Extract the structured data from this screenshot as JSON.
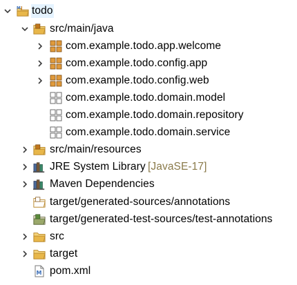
{
  "tree": {
    "root": {
      "label": "todo"
    },
    "items": [
      {
        "label": "src/main/java"
      },
      {
        "label": "com.example.todo.app.welcome"
      },
      {
        "label": "com.example.todo.config.app"
      },
      {
        "label": "com.example.todo.config.web"
      },
      {
        "label": "com.example.todo.domain.model"
      },
      {
        "label": "com.example.todo.domain.repository"
      },
      {
        "label": "com.example.todo.domain.service"
      },
      {
        "label": "src/main/resources"
      },
      {
        "label": "JRE System Library",
        "decoration": "[JavaSE-17]"
      },
      {
        "label": "Maven Dependencies"
      },
      {
        "label": "target/generated-sources/annotations"
      },
      {
        "label": "target/generated-test-sources/test-annotations"
      },
      {
        "label": "src"
      },
      {
        "label": "target"
      },
      {
        "label": "pom.xml"
      }
    ]
  },
  "colors": {
    "twisty": "#3c3c3c",
    "folder": "#e8b74a",
    "package": "#c0761c",
    "empty_package": "#6b6b6b",
    "library": "#4a6a9a",
    "maven_blue": "#3c6fb8"
  }
}
